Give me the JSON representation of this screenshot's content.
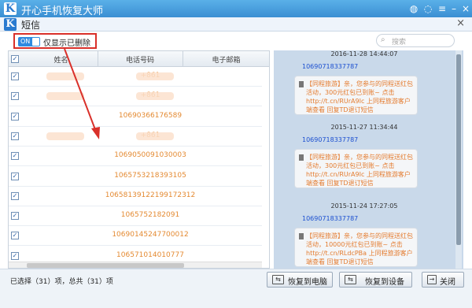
{
  "app": {
    "logo_letter": "K",
    "title": "开心手机恢复大师"
  },
  "window_controls": [
    "wechat-icon",
    "chat-icon",
    "menu-icon",
    "minimize-icon",
    "close-icon"
  ],
  "panel": {
    "logo_letter": "K",
    "title": "短信",
    "close": "×"
  },
  "toolbar": {
    "toggle_label": "ON",
    "filter_label": "仅显示已删除",
    "search_placeholder": "搜索"
  },
  "list": {
    "columns": [
      "姓名",
      "电话号码",
      "电子邮箱"
    ],
    "rows": [
      {
        "phone": "+861",
        "checked": true,
        "blurred": true
      },
      {
        "phone": "+861",
        "checked": true,
        "blurred": true
      },
      {
        "phone": "10690366176589",
        "checked": true,
        "blurred": false
      },
      {
        "phone": "+861",
        "checked": true,
        "blurred": true
      },
      {
        "phone": "1069050091030003",
        "checked": true,
        "blurred": false
      },
      {
        "phone": "1065753218393105",
        "checked": true,
        "blurred": false
      },
      {
        "phone": "1065813912219917231​2",
        "checked": true,
        "blurred": false
      },
      {
        "phone": "1065752182091",
        "checked": true,
        "blurred": false
      },
      {
        "phone": "10690145247700012",
        "checked": true,
        "blurred": false
      },
      {
        "phone": "106571014010777",
        "checked": true,
        "blurred": false
      }
    ]
  },
  "messages": [
    {
      "time": "2016-11-28 14:44:07",
      "from": "10690718337787",
      "text": "【同程旅游】亲，您参与的同程送红包活动，300元红包已到账~ 点击http://t.cn/RUrA9Ic 上同程旅游客户端查看 回复TD退订短信"
    },
    {
      "time": "2015-11-27 11:34:44",
      "from": "10690718337787",
      "text": "【同程旅游】亲，您参与的同程送红包活动，300元红包已到账~ 点击http://t.cn/RUrA9Ic 上同程旅游客户端查看 回复TD退订短信"
    },
    {
      "time": "2015-11-24 17:27:05",
      "from": "10690718337787",
      "text": "【同程旅游】亲，您参与的同程送红包活动，10000元红包已到账~ 点击http://t.cn/RLdcPBa 上同程旅游客户端查看 回复TD退订短信"
    }
  ],
  "footer": {
    "status": "已选择（31）项，总共（31）项",
    "restore_pc": "恢复到电脑",
    "restore_device": "恢复到设备",
    "close": "关闭"
  },
  "colors": {
    "accent": "#2a7bd0",
    "phone_text": "#e48a32",
    "highlight": "#d9302a",
    "message_sender": "#1b4fd0"
  }
}
